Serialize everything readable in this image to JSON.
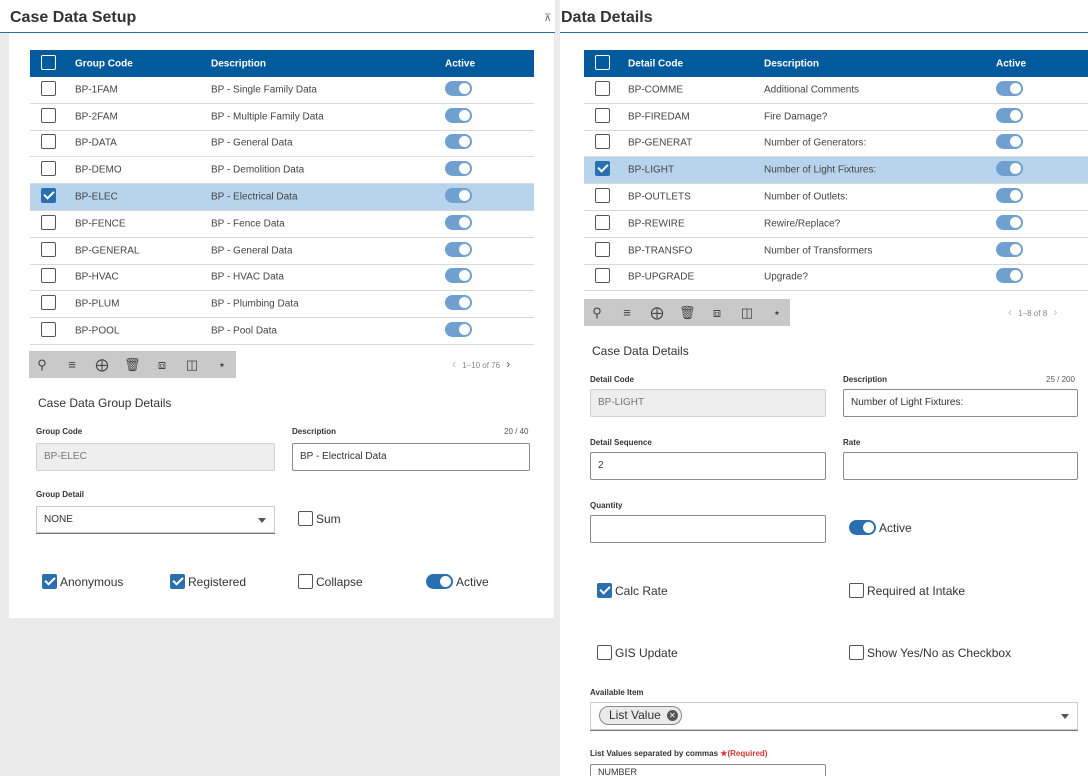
{
  "left": {
    "title": "Case Data Setup",
    "grid": {
      "headers": {
        "code": "Group Code",
        "description": "Description",
        "active": "Active"
      },
      "rows": [
        {
          "code": "BP-1FAM",
          "description": "BP - Single Family Data",
          "selected": false
        },
        {
          "code": "BP-2FAM",
          "description": "BP - Multiple Family Data",
          "selected": false
        },
        {
          "code": "BP-DATA",
          "description": "BP - General Data",
          "selected": false
        },
        {
          "code": "BP-DEMO",
          "description": "BP - Demolition Data",
          "selected": false
        },
        {
          "code": "BP-ELEC",
          "description": "BP - Electrical Data",
          "selected": true
        },
        {
          "code": "BP-FENCE",
          "description": "BP - Fence Data",
          "selected": false
        },
        {
          "code": "BP-GENERAL",
          "description": "BP - General Data",
          "selected": false
        },
        {
          "code": "BP-HVAC",
          "description": "BP - HVAC Data",
          "selected": false
        },
        {
          "code": "BP-PLUM",
          "description": "BP - Plumbing Data",
          "selected": false
        },
        {
          "code": "BP-POOL",
          "description": "BP - Pool Data",
          "selected": false
        }
      ]
    },
    "pager": "1–10 of 76",
    "details": {
      "title": "Case Data Group Details",
      "group_code_label": "Group Code",
      "group_code_value": "BP-ELEC",
      "description_label": "Description",
      "description_count": "20 / 40",
      "description_value": "BP - Electrical Data",
      "group_detail_label": "Group Detail",
      "group_detail_value": "NONE",
      "sum_label": "Sum",
      "anonymous_label": "Anonymous",
      "registered_label": "Registered",
      "collapse_label": "Collapse",
      "active_label": "Active"
    }
  },
  "right": {
    "title": "Data Details",
    "grid": {
      "headers": {
        "code": "Detail Code",
        "description": "Description",
        "active": "Active"
      },
      "rows": [
        {
          "code": "BP-COMME",
          "description": "Additional Comments",
          "selected": false
        },
        {
          "code": "BP-FIREDAM",
          "description": "Fire Damage?",
          "selected": false
        },
        {
          "code": "BP-GENERAT",
          "description": "Number of Generators:",
          "selected": false
        },
        {
          "code": "BP-LIGHT",
          "description": "Number of Light Fixtures:",
          "selected": true
        },
        {
          "code": "BP-OUTLETS",
          "description": "Number of Outlets:",
          "selected": false
        },
        {
          "code": "BP-REWIRE",
          "description": "Rewire/Replace?",
          "selected": false
        },
        {
          "code": "BP-TRANSFO",
          "description": "Number of Transformers",
          "selected": false
        },
        {
          "code": "BP-UPGRADE",
          "description": "Upgrade?",
          "selected": false
        }
      ]
    },
    "pager": "1–8 of 8",
    "details": {
      "title": "Case Data Details",
      "detail_code_label": "Detail Code",
      "detail_code_value": "BP-LIGHT",
      "description_label": "Description",
      "description_count": "25 / 200",
      "description_value": "Number of Light Fixtures:",
      "sequence_label": "Detail Sequence",
      "sequence_value": "2",
      "rate_label": "Rate",
      "rate_value": "",
      "quantity_label": "Quantity",
      "quantity_value": "",
      "active_label": "Active",
      "calc_rate_label": "Calc Rate",
      "required_intake_label": "Required at Intake",
      "gis_update_label": "GIS Update",
      "show_yes_no_label": "Show Yes/No as Checkbox",
      "available_item_label": "Available Item",
      "available_item_chip": "List Value",
      "list_values_label": "List Values separated by commas",
      "required_marker": "★(Required)",
      "list_values_value": "NUMBER"
    }
  },
  "icons": [
    "search-icon",
    "filter-icon",
    "add-icon",
    "delete-icon",
    "copy-icon",
    "columns-icon",
    "hierarchy-icon"
  ]
}
